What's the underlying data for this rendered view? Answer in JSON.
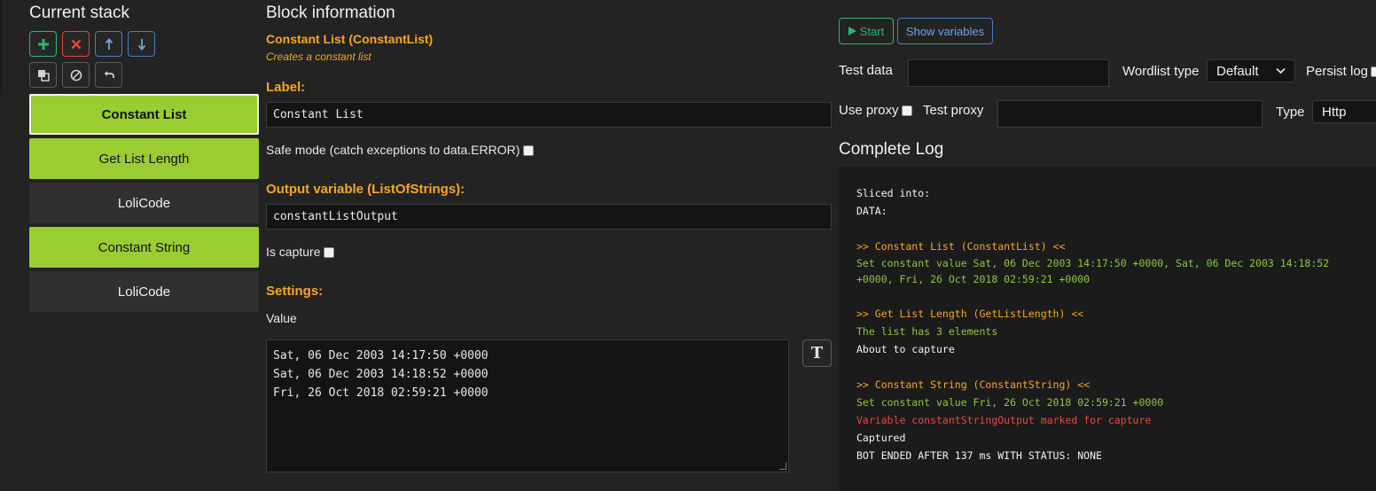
{
  "stack": {
    "title": "Current stack",
    "toolbar_row1": [
      {
        "icon": "plus-icon",
        "color": "#2bb673"
      },
      {
        "icon": "close-icon",
        "color": "#e0463c"
      },
      {
        "icon": "arrow-up-icon",
        "color": "#4a7dc0"
      },
      {
        "icon": "arrow-down-icon",
        "color": "#4a7dc0"
      }
    ],
    "toolbar_row2": [
      {
        "icon": "clone-icon"
      },
      {
        "icon": "disable-icon"
      },
      {
        "icon": "undo-icon"
      }
    ],
    "blocks": [
      {
        "label": "Constant List",
        "style": "lime",
        "selected": true
      },
      {
        "label": "Get List Length",
        "style": "lime",
        "selected": false
      },
      {
        "label": "LoliCode",
        "style": "dark",
        "selected": false
      },
      {
        "label": "Constant String",
        "style": "lime",
        "selected": false
      },
      {
        "label": "LoliCode",
        "style": "dark",
        "selected": false
      }
    ]
  },
  "block_info": {
    "title": "Block information",
    "block_name": "Constant List (ConstantList)",
    "block_description": "Creates a constant list",
    "label_heading": "Label:",
    "label_value": "Constant List",
    "safe_mode_label": "Safe mode (catch exceptions to data.ERROR)",
    "output_heading": "Output variable (ListOfStrings):",
    "output_value": "constantListOutput",
    "is_capture_label": "Is capture",
    "settings_heading": "Settings:",
    "value_label": "Value",
    "value_lines": [
      "Sat, 06 Dec 2003 14:17:50 +0000",
      "Sat, 06 Dec 2003 14:18:52 +0000",
      "Fri, 26 Oct 2018 02:59:21 +0000"
    ]
  },
  "debugger": {
    "start_label": "Start",
    "show_variables_label": "Show variables",
    "test_data_label": "Test data",
    "test_data_value": "",
    "wordlist_type_label": "Wordlist type",
    "wordlist_type_value": "Default",
    "persist_log_label": "Persist log",
    "use_proxy_label": "Use proxy",
    "test_proxy_label": "Test proxy",
    "test_proxy_value": "",
    "type_label": "Type",
    "type_value": "Http",
    "complete_log_title": "Complete Log",
    "log": [
      {
        "text": "Sliced into:",
        "color": "white"
      },
      {
        "text": "DATA:",
        "color": "white"
      },
      {
        "text": "",
        "color": "white"
      },
      {
        "text": ">> Constant List (ConstantList) <<",
        "color": "orange"
      },
      {
        "text": "Set constant value Sat, 06 Dec 2003 14:17:50 +0000, Sat, 06 Dec 2003 14:18:52 +0000, Fri, 26 Oct 2018 02:59:21 +0000",
        "color": "green",
        "wrap": true
      },
      {
        "text": "",
        "color": "white"
      },
      {
        "text": ">> Get List Length (GetListLength) <<",
        "color": "orange"
      },
      {
        "text": "The list has 3 elements",
        "color": "green"
      },
      {
        "text": "About to capture",
        "color": "white"
      },
      {
        "text": "",
        "color": "white"
      },
      {
        "text": ">> Constant String (ConstantString) <<",
        "color": "orange"
      },
      {
        "text": "Set constant value Fri, 26 Oct 2018 02:59:21 +0000",
        "color": "green"
      },
      {
        "text": "Variable constantStringOutput marked for capture",
        "color": "red"
      },
      {
        "text": "Captured",
        "color": "white"
      },
      {
        "text": "BOT ENDED AFTER 137 ms WITH STATUS: NONE",
        "color": "white"
      }
    ]
  },
  "colors": {
    "accent_orange": "#f5a623",
    "block_lime": "#9acd32",
    "start_green": "#2bb673",
    "danger_red": "#e0463c",
    "info_blue": "#4a7dc0"
  }
}
